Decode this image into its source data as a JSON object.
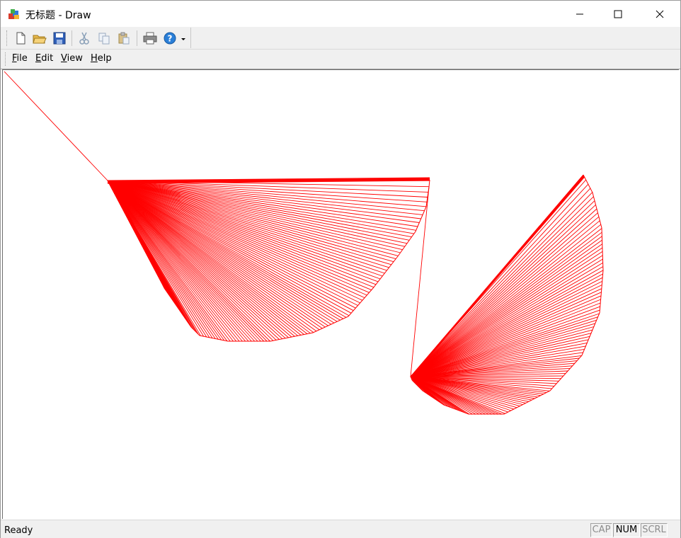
{
  "window": {
    "title": "无标题 - Draw",
    "app_icon": "paint-app-icon"
  },
  "titlebar_controls": [
    "minimize-icon",
    "maximize-icon",
    "close-icon"
  ],
  "toolbar": {
    "buttons": [
      "new-icon",
      "open-icon",
      "save-icon",
      "cut-icon",
      "copy-icon",
      "paste-icon",
      "print-icon",
      "help-icon",
      "dropdown-arrow-icon"
    ]
  },
  "menu": {
    "items": [
      {
        "accel": "F",
        "rest": "ile"
      },
      {
        "accel": "E",
        "rest": "dit"
      },
      {
        "accel": "V",
        "rest": "iew"
      },
      {
        "accel": "H",
        "rest": "elp"
      }
    ]
  },
  "status": {
    "text": "Ready",
    "indicators": [
      {
        "label": "CAP",
        "active": false
      },
      {
        "label": "NUM",
        "active": true
      },
      {
        "label": "SCRL",
        "active": false
      }
    ]
  },
  "colors": {
    "stroke": "#ff0000",
    "chrome": "#f0f0f0"
  }
}
